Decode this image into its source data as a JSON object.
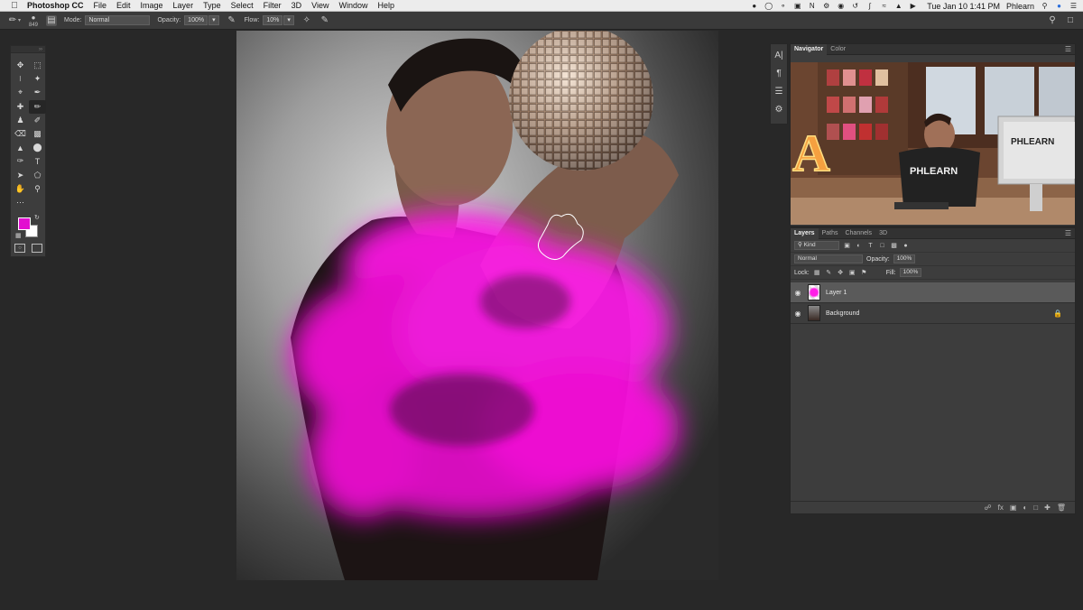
{
  "menubar": {
    "app_name": "Photoshop CC",
    "items": [
      "File",
      "Edit",
      "Image",
      "Layer",
      "Type",
      "Select",
      "Filter",
      "3D",
      "View",
      "Window",
      "Help"
    ],
    "clock": "Tue Jan 10  1:41 PM",
    "user": "Phlearn"
  },
  "options": {
    "brush_size": "849",
    "mode_label": "Mode:",
    "mode_value": "Normal",
    "opacity_label": "Opacity:",
    "opacity_value": "100%",
    "flow_label": "Flow:",
    "flow_value": "10%"
  },
  "colors": {
    "foreground": "#e20fd0",
    "background": "#ffffff",
    "accent_magenta": "#ff1ee6"
  },
  "navigator": {
    "tabs": [
      "Navigator",
      "Color"
    ],
    "active_tab": "Navigator",
    "preview_text": [
      "A",
      "PHLEARN",
      "PHLEARN"
    ]
  },
  "layers_panel": {
    "tabs": [
      "Layers",
      "Paths",
      "Channels",
      "3D"
    ],
    "active_tab": "Layers",
    "filter_kind": "Kind",
    "blend_mode": "Normal",
    "opacity_label": "Opacity:",
    "opacity_value": "100%",
    "lock_label": "Lock:",
    "fill_label": "Fill:",
    "fill_value": "100%",
    "layers": [
      {
        "name": "Layer 1",
        "selected": true,
        "locked": false
      },
      {
        "name": "Background",
        "selected": false,
        "locked": true
      }
    ]
  }
}
